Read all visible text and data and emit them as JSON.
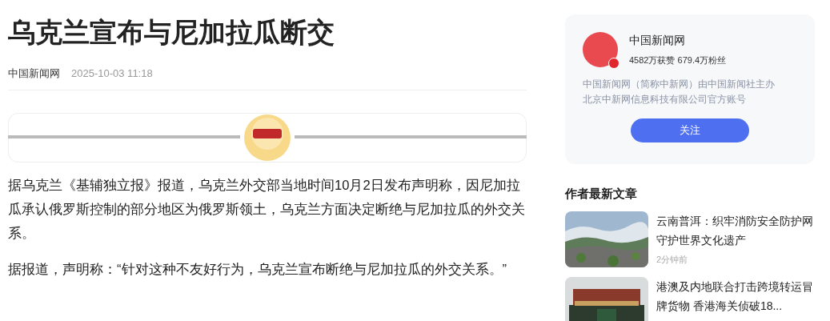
{
  "article": {
    "title": "乌克兰宣布与尼加拉瓜断交",
    "source": "中国新闻网",
    "time": "2025-10-03 11:18",
    "paragraphs": [
      "据乌克兰《基辅独立报》报道，乌克兰外交部当地时间10月2日发布声明称，因尼加拉瓜承认俄罗斯控制的部分地区为俄罗斯领土，乌克兰方面决定断绝与尼加拉瓜的外交关系。",
      "据报道，声明称：“针对这种不友好行为，乌克兰宣布断绝与尼加拉瓜的外交关系。”"
    ]
  },
  "author_card": {
    "name": "中国新闻网",
    "verified": true,
    "stats": "4582万获赞 679.4万粉丝",
    "description": "中国新闻网（简称中新网）由中国新闻社主办北京中新网信息科技有限公司官方账号",
    "follow_button": "关注"
  },
  "latest_articles": {
    "heading": "作者最新文章",
    "items": [
      {
        "title": "云南普洱：织牢消防安全防护网守护世界文化遗产",
        "time": "2分钟前"
      },
      {
        "title": "港澳及内地联合打击跨境转运冒牌货物 香港海关侦破18..."
      }
    ]
  }
}
